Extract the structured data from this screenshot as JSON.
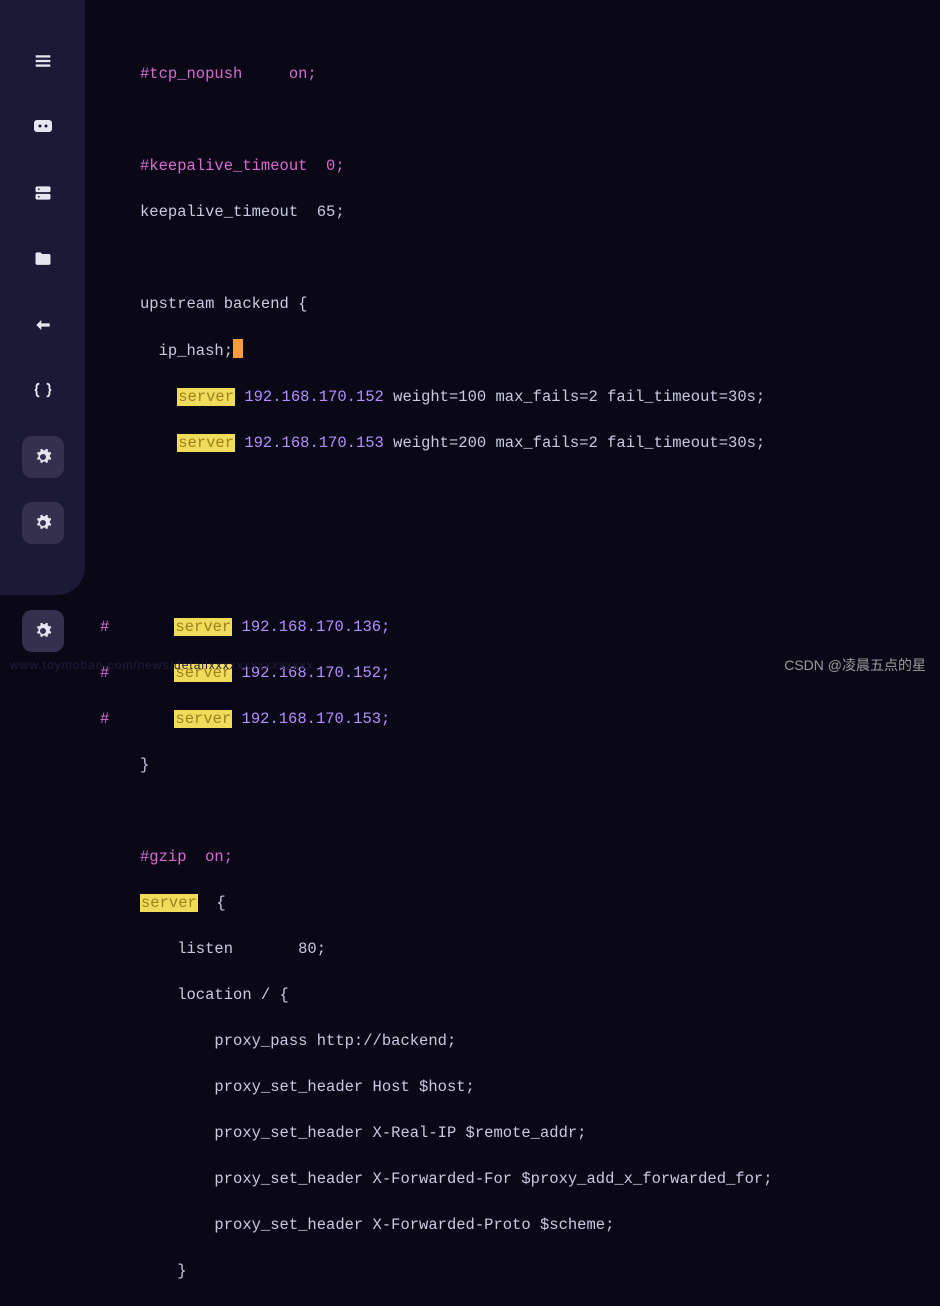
{
  "code": {
    "l1": "#tcp_nopush     on;",
    "l2": "#keepalive_timeout  0;",
    "l3_a": "keepalive_timeout  ",
    "l3_b": "65;",
    "l4": "upstream backend {",
    "l5": "  ip_hash;",
    "l6_hl": "server",
    "l6_ip": " 192.168.170.152",
    "l6_rest": " weight=100 max_fails=2 fail_timeout=30s;",
    "l7_hl": "server",
    "l7_ip": " 192.168.170.153",
    "l7_rest": " weight=200 max_fails=2 fail_timeout=30s;",
    "l8_hash": "#       ",
    "l8_srv": "server",
    "l8_ip": " 192.168.170.136;",
    "l9_hash": "#       ",
    "l9_srv": "server",
    "l9_ip": " 192.168.170.152;",
    "l10_hash": "#       ",
    "l10_srv": "server",
    "l10_ip": " 192.168.170.153;",
    "l11": "}",
    "l12": "#gzip  on;",
    "l13_srv": "server",
    "l13_rest": "  {",
    "l14": "    listen       80;",
    "l15": "    location / {",
    "l16": "        proxy_pass http://backend;",
    "l17": "        proxy_set_header Host $host;",
    "l18": "        proxy_set_header X-Real-IP $remote_addr;",
    "l19": "        proxy_set_header X-Forwarded-For $proxy_add_x_forwarded_for;",
    "l20": "        proxy_set_header X-Forwarded-Proto $scheme;",
    "l21": "    }"
  },
  "watermark": "CSDN @凌晨五点的星",
  "footer": "www.toymoban.com/news/detailxxxxxxxxxxxxxxx"
}
